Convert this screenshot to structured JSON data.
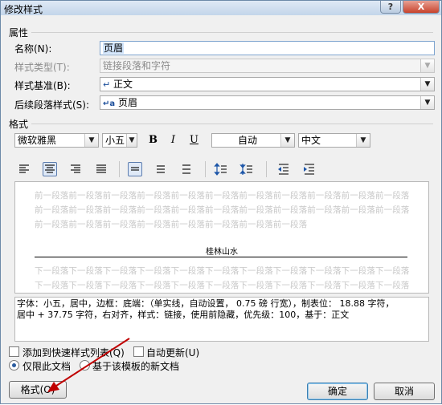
{
  "window": {
    "title": "修改样式",
    "help_label": "?",
    "close_label": "X"
  },
  "properties": {
    "section_title": "属性",
    "name_label": "名称(N):",
    "name_value": "页眉",
    "style_type_label": "样式类型(T):",
    "style_type_value": "链接段落和字符",
    "based_on_label": "样式基准(B):",
    "based_on_value": "正文",
    "based_on_icon": "paragraph-mark-icon",
    "next_style_label": "后续段落样式(S):",
    "next_style_value": "页眉",
    "next_style_icon": "linked-style-icon"
  },
  "formatting": {
    "section_title": "格式",
    "font": "微软雅黑",
    "size": "小五",
    "bold_label": "B",
    "italic_label": "I",
    "underline_label": "U",
    "color": "自动",
    "script": "中文"
  },
  "toolbar_icons": [
    "align-left-icon",
    "align-center-icon",
    "align-right-icon",
    "justify-icon",
    "single-spacing-icon",
    "one-half-spacing-icon",
    "double-spacing-icon",
    "increase-paragraph-spacing-icon",
    "decrease-paragraph-spacing-icon",
    "decrease-indent-icon",
    "increase-indent-icon"
  ],
  "preview": {
    "prev_para": "前一段落前一段落前一段落前一段落前一段落前一段落前一段落前一段落前一段落前一段落前一段落前一段落前一段落前一段落前一段落前一段落前一段落前一段落前一段落前一段落前一段落前一段落前一段落前一段落前一段落前一段落前一段落前一段落前一段落前一段落",
    "current": "桂林山水",
    "next_para": "下一段落下一段落下一段落下一段落下一段落下一段落下一段落下一段落下一段落下一段落下一段落下一段落下一段落下一段落下一段落下一段落下一段落下一段落下一段落下一段落下一段落下一段落下一段落下一段落下一段落下一段落下一段落下一段落下一段落下一段落下一段落下一段落下一段落下一段落下一段落下一段落"
  },
  "description": {
    "line1": "字体：小五，居中，边框：底端：（单实线，自动设置，  0.75 磅 行宽），制表位：  18.88 字符，",
    "line2": "居中 +  37.75 字符，右对齐，样式：链接，使用前隐藏，优先级：100，基于：正文"
  },
  "options": {
    "add_to_quick_label": "添加到快速样式列表(Q)",
    "auto_update_label": "自动更新(U)",
    "only_this_doc_label": "仅限此文档",
    "new_docs_label": "基于该模板的新文档"
  },
  "buttons": {
    "format": "格式(O)",
    "ok": "确定",
    "cancel": "取消"
  },
  "colors": {
    "accent": "#3c7fb1",
    "selection": "#cfe3fa",
    "title_bar": "#c3d5ea",
    "close": "#c8432c",
    "annotation_arrow": "#c00000"
  }
}
